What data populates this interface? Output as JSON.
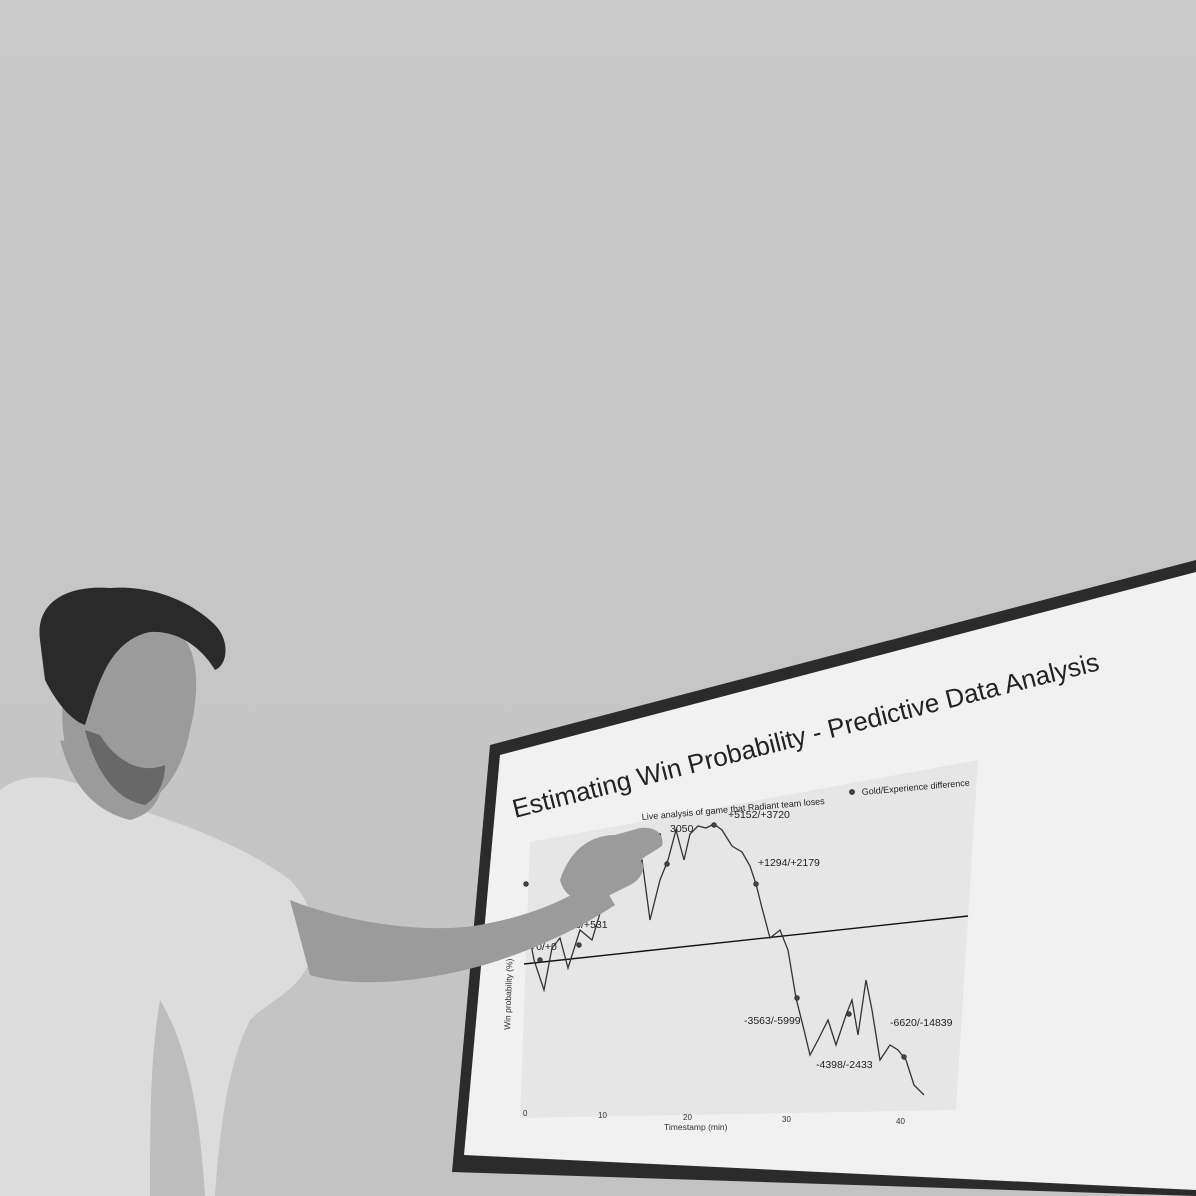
{
  "slide": {
    "title": "Estimating Win Probability - Predictive Data Analysis",
    "chart_title": "Live analysis of game that Radiant team loses",
    "legend_label": "Gold/Experience difference",
    "x_axis_label": "Timestamp (min)",
    "y_axis_label": "Win probability (%)",
    "x_ticks": [
      "0",
      "10",
      "20",
      "30",
      "40"
    ],
    "annotations": [
      "+0/+0",
      "-176/+531",
      "+32",
      "3050",
      "+5152/+3720",
      "+1294/+2179",
      "-3563/-5999",
      "-4398/-2433",
      "-6620/-14839"
    ]
  },
  "colors": {
    "wall": "#c8c8c8",
    "frame": "#2b2b2b",
    "screen": "#f1f1f1"
  }
}
